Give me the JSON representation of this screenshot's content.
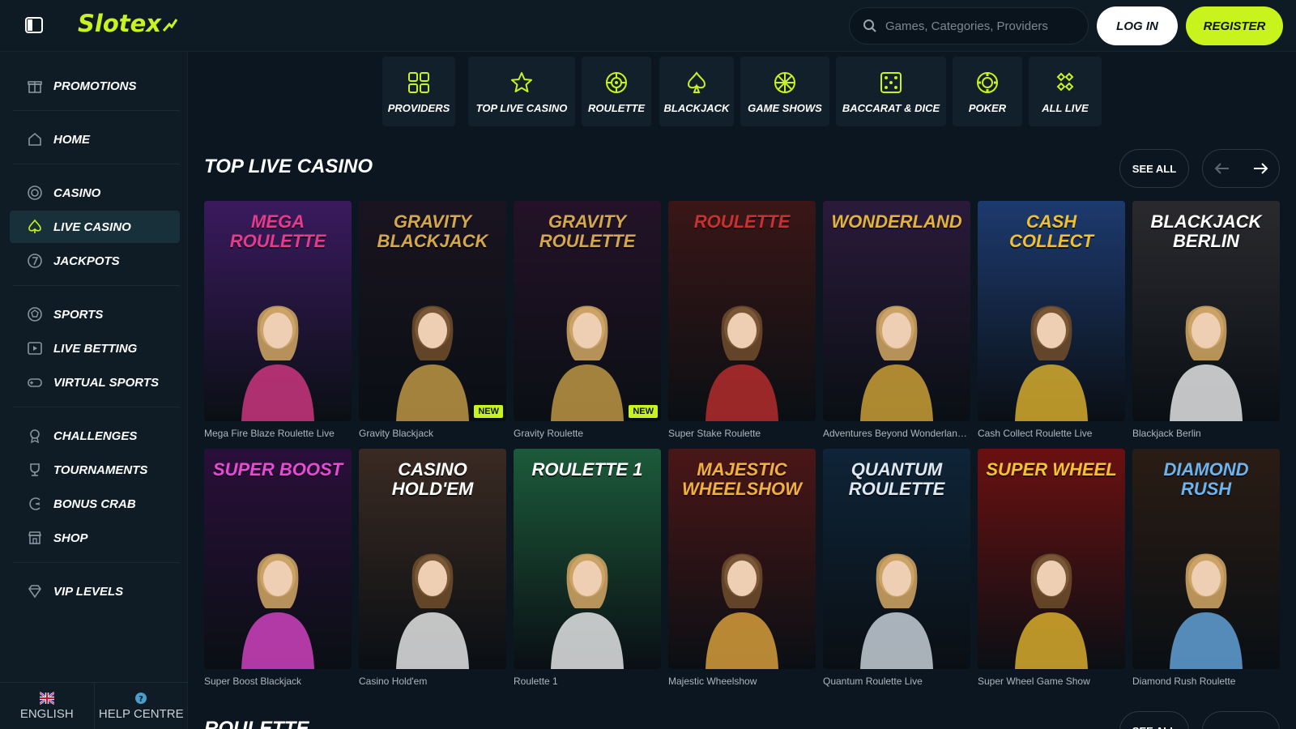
{
  "header": {
    "logo_text": "Slotex",
    "search_placeholder": "Games, Categories, Providers",
    "login_label": "LOG IN",
    "register_label": "REGISTER"
  },
  "sidebar": {
    "items": [
      {
        "label": "PROMOTIONS",
        "icon": "gift-icon"
      },
      {
        "label": "HOME",
        "icon": "home-icon"
      },
      {
        "label": "CASINO",
        "icon": "chip-icon"
      },
      {
        "label": "LIVE CASINO",
        "icon": "spade-icon"
      },
      {
        "label": "JACKPOTS",
        "icon": "seven-icon"
      },
      {
        "label": "SPORTS",
        "icon": "ball-icon"
      },
      {
        "label": "LIVE BETTING",
        "icon": "play-icon"
      },
      {
        "label": "VIRTUAL SPORTS",
        "icon": "gamepad-icon"
      },
      {
        "label": "CHALLENGES",
        "icon": "medal-icon"
      },
      {
        "label": "TOURNAMENTS",
        "icon": "trophy-icon"
      },
      {
        "label": "BONUS CRAB",
        "icon": "claw-icon"
      },
      {
        "label": "SHOP",
        "icon": "shop-icon"
      },
      {
        "label": "VIP LEVELS",
        "icon": "diamond-icon"
      }
    ],
    "footer": {
      "language_label": "ENGLISH",
      "help_label": "HELP CENTRE"
    }
  },
  "categories": [
    {
      "label": "PROVIDERS",
      "icon": "grid-icon"
    },
    {
      "label": "TOP LIVE CASINO",
      "icon": "star-icon"
    },
    {
      "label": "ROULETTE",
      "icon": "roulette-icon"
    },
    {
      "label": "BLACKJACK",
      "icon": "spade-icon"
    },
    {
      "label": "GAME SHOWS",
      "icon": "wheel-icon"
    },
    {
      "label": "BACCARAT & DICE",
      "icon": "dice-icon"
    },
    {
      "label": "POKER",
      "icon": "chip-icon"
    },
    {
      "label": "ALL LIVE",
      "icon": "clover-icon"
    }
  ],
  "section": {
    "title": "TOP LIVE CASINO",
    "see_all": "SEE ALL"
  },
  "section2": {
    "title": "ROULETTE",
    "see_all": "SEE ALL"
  },
  "games_row1": [
    {
      "name": "Mega Fire Blaze Roulette Live",
      "art": "MEGA ROULETTE",
      "badge": "",
      "bg": "#3a1a5e",
      "accent": "#e43b8c"
    },
    {
      "name": "Gravity Blackjack",
      "art": "GRAVITY BLACKJACK",
      "badge": "NEW",
      "bg": "#1a1420",
      "accent": "#d4a84a"
    },
    {
      "name": "Gravity Roulette",
      "art": "GRAVITY ROULETTE",
      "badge": "NEW",
      "bg": "#241228",
      "accent": "#d4a84a"
    },
    {
      "name": "Super Stake Roulette",
      "art": "ROULETTE",
      "badge": "",
      "bg": "#3a1616",
      "accent": "#c93030"
    },
    {
      "name": "Adventures Beyond Wonderland ...",
      "art": "WONDERLAND",
      "badge": "",
      "bg": "#2a1a3a",
      "accent": "#e3b23a"
    },
    {
      "name": "Cash Collect Roulette Live",
      "art": "CASH COLLECT",
      "badge": "",
      "bg": "#1d3a6e",
      "accent": "#f0c030"
    },
    {
      "name": "Blackjack Berlin",
      "art": "BLACKJACK BERLIN",
      "badge": "",
      "bg": "#2a2a2e",
      "accent": "#ffffff"
    }
  ],
  "games_row2": [
    {
      "name": "Super Boost Blackjack",
      "art": "SUPER BOOST",
      "badge": "",
      "bg": "#2a0f3a",
      "accent": "#e84ad6"
    },
    {
      "name": "Casino Hold'em",
      "art": "CASINO HOLD'EM",
      "badge": "",
      "bg": "#3a2a22",
      "accent": "#ffffff"
    },
    {
      "name": "Roulette 1",
      "art": "ROULETTE 1",
      "badge": "",
      "bg": "#1c5a3a",
      "accent": "#ffffff"
    },
    {
      "name": "Majestic Wheelshow",
      "art": "MAJESTIC WHEELSHOW",
      "badge": "",
      "bg": "#4a1616",
      "accent": "#f0b040"
    },
    {
      "name": "Quantum Roulette Live",
      "art": "QUANTUM ROULETTE",
      "badge": "",
      "bg": "#0e2438",
      "accent": "#dfe8f0"
    },
    {
      "name": "Super Wheel Game Show",
      "art": "SUPER WHEEL",
      "badge": "",
      "bg": "#6a1010",
      "accent": "#f2c230"
    },
    {
      "name": "Diamond Rush Roulette",
      "art": "DIAMOND RUSH",
      "badge": "",
      "bg": "#2a1c14",
      "accent": "#6cb4f0"
    }
  ],
  "colors": {
    "accent": "#c8f31d",
    "background": "#0c1620",
    "panel": "#12202b"
  }
}
